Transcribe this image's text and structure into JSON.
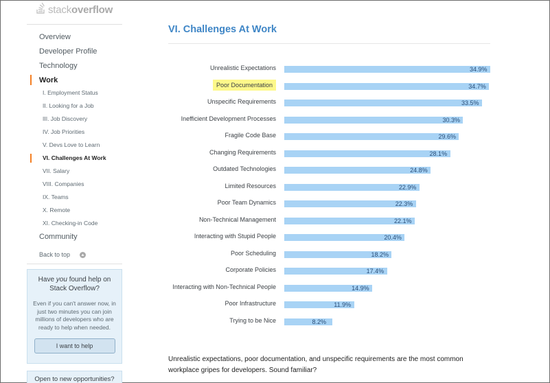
{
  "logo": {
    "text_light": "stack",
    "text_bold": "overflow",
    "icon": "stackoverflow-logo-icon"
  },
  "nav": {
    "top_items": [
      {
        "label": "Overview",
        "active": false
      },
      {
        "label": "Developer Profile",
        "active": false
      },
      {
        "label": "Technology",
        "active": false
      },
      {
        "label": "Work",
        "active": true
      }
    ],
    "sub_items": [
      {
        "label": "I. Employment Status",
        "active": false
      },
      {
        "label": "II. Looking for a Job",
        "active": false
      },
      {
        "label": "III. Job Discovery",
        "active": false
      },
      {
        "label": "IV. Job Priorities",
        "active": false
      },
      {
        "label": "V. Devs Love to Learn",
        "active": false
      },
      {
        "label": "VI. Challenges At Work",
        "active": true
      },
      {
        "label": "VII. Salary",
        "active": false
      },
      {
        "label": "VIII. Companies",
        "active": false
      },
      {
        "label": "IX. Teams",
        "active": false
      },
      {
        "label": "X. Remote",
        "active": false
      },
      {
        "label": "XI. Checking-in Code",
        "active": false
      }
    ],
    "community": "Community",
    "back_to_top": "Back to top"
  },
  "help_box": {
    "title_pre": "Have ",
    "title_em": "you",
    "title_post": " found help on Stack Overflow?",
    "body": "Even if you can't answer now, in just two minutes you can join millions of developers who are ready to help when needed.",
    "button": "I want to help"
  },
  "cut_box": {
    "text": "Open to new opportunities?"
  },
  "main": {
    "title": "VI. Challenges At Work",
    "summary": "Unrealistic expectations, poor documentation, and unspecific requirements are the most common workplace gripes for developers. Sound familiar?"
  },
  "colors": {
    "accent": "#f48024",
    "title": "#3f86c6",
    "bar": "#a8d3f5",
    "highlight": "#fdf88a"
  },
  "chart_data": {
    "type": "bar",
    "orientation": "horizontal",
    "categories": [
      "Unrealistic Expectations",
      "Poor Documentation",
      "Unspecific Requirements",
      "Inefficient Development Processes",
      "Fragile Code Base",
      "Changing Requirements",
      "Outdated Technologies",
      "Limited Resources",
      "Poor Team Dynamics",
      "Non-Technical Management",
      "Interacting with Stupid People",
      "Poor Scheduling",
      "Corporate Policies",
      "Interacting with Non-Technical People",
      "Poor Infrastructure",
      "Trying to be Nice"
    ],
    "values": [
      34.9,
      34.7,
      33.5,
      30.3,
      29.6,
      28.1,
      24.8,
      22.9,
      22.3,
      22.1,
      20.4,
      18.2,
      17.4,
      14.9,
      11.9,
      8.2
    ],
    "value_labels": [
      "34.9%",
      "34.7%",
      "33.5%",
      "30.3%",
      "29.6%",
      "28.1%",
      "24.8%",
      "22.9%",
      "22.3%",
      "22.1%",
      "20.4%",
      "18.2%",
      "17.4%",
      "14.9%",
      "11.9%",
      "8.2%"
    ],
    "highlighted": "Poor Documentation",
    "xlim": [
      0,
      34.9
    ],
    "grid": false,
    "legend": "none"
  }
}
